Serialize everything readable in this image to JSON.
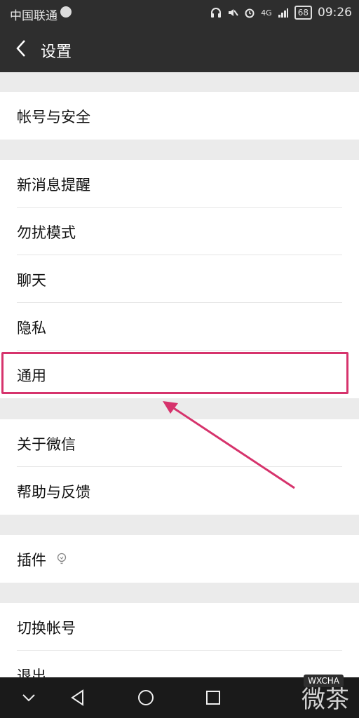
{
  "status_bar": {
    "carrier": "中国联通",
    "battery": "68",
    "network": "4G",
    "time": "09:26"
  },
  "nav": {
    "title": "设置"
  },
  "groups": [
    {
      "items": [
        "帐号与安全"
      ]
    },
    {
      "items": [
        "新消息提醒",
        "勿扰模式",
        "聊天",
        "隐私",
        "通用"
      ]
    },
    {
      "items": [
        "关于微信",
        "帮助与反馈"
      ]
    },
    {
      "items": [
        "插件"
      ]
    },
    {
      "items": [
        "切换帐号",
        "退出"
      ]
    }
  ],
  "watermark": {
    "text": "微茶",
    "badge": "WXCHA"
  },
  "colors": {
    "header": "#2e2e2e",
    "highlight": "#d6336c"
  }
}
